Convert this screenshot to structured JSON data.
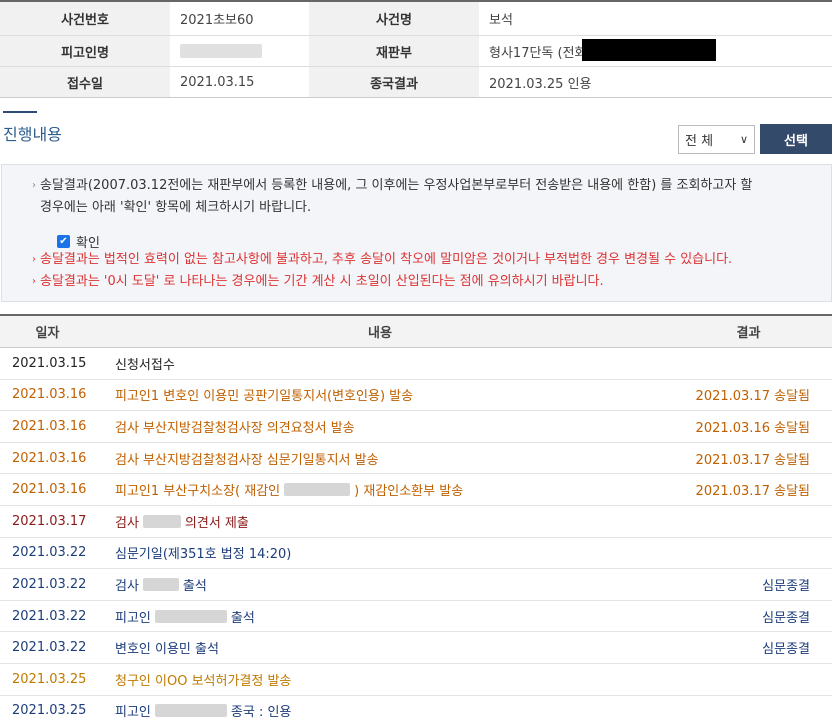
{
  "case_info": {
    "case_number_label": "사건번호",
    "case_number": "2021초보60",
    "case_name_label": "사건명",
    "case_name": "보석",
    "defendant_label": "피고인명",
    "court_label": "재판부",
    "court": "형사17단독 (전화",
    "filing_date_label": "접수일",
    "filing_date": "2021.03.15",
    "final_result_label": "종국결과",
    "final_result": "2021.03.25 인용"
  },
  "section_title": "진행내용",
  "filter": {
    "selected": "전 체",
    "button": "선택"
  },
  "notice": {
    "line1": "송달결과(2007.03.12전에는 재판부에서 등록한 내용에, 그 이후에는 우정사업본부로부터 전송받은 내용에 한함) 를 조회하고자 할",
    "line2": "경우에는 아래 '확인' 항목에 체크하시기 바랍니다.",
    "checkbox_label": "확인",
    "warn1": "송달결과는 법적인 효력이 없는 참고사항에 불과하고, 추후 송달이 착오에 말미암은 것이거나 부적법한 경우 변경될 수 있습니다.",
    "warn2": "송달결과는 '0시 도달' 로 나타나는 경우에는 기간 계산 시 초일이 산입된다는 점에 유의하시기 바랍니다."
  },
  "table": {
    "headers": {
      "date": "일자",
      "content": "내용",
      "result": "결과"
    },
    "rows": [
      {
        "date": "2021.03.15",
        "pre": "신청서접수",
        "post": "",
        "result": "",
        "color": "black"
      },
      {
        "date": "2021.03.16",
        "pre": "피고인1 변호인 이용민 공판기일통지서(변호인용) 발송",
        "post": "",
        "result": "2021.03.17 송달됨",
        "color": "orange"
      },
      {
        "date": "2021.03.16",
        "pre": "검사 부산지방검찰청검사장 의견요청서 발송",
        "post": "",
        "result": "2021.03.16 송달됨",
        "color": "orange"
      },
      {
        "date": "2021.03.16",
        "pre": "검사 부산지방검찰청검사장 심문기일통지서 발송",
        "post": "",
        "result": "2021.03.17 송달됨",
        "color": "orange"
      },
      {
        "date": "2021.03.16",
        "pre": "피고인1 부산구치소장( 재감인",
        "post": ") 재감인소환부 발송",
        "result": "2021.03.17 송달됨",
        "color": "orange"
      },
      {
        "date": "2021.03.17",
        "pre": "검사",
        "post": "의견서 제출",
        "result": "",
        "color": "maroon"
      },
      {
        "date": "2021.03.22",
        "pre": "심문기일(제351호 법정 14:20)",
        "post": "",
        "result": "",
        "color": "blue"
      },
      {
        "date": "2021.03.22",
        "pre": "검사",
        "post": "출석",
        "result": "심문종결",
        "color": "blue"
      },
      {
        "date": "2021.03.22",
        "pre": "피고인",
        "post": "출석",
        "result": "심문종결",
        "color": "blue"
      },
      {
        "date": "2021.03.22",
        "pre": "변호인 이용민 출석",
        "post": "",
        "result": "심문종결",
        "color": "blue"
      },
      {
        "date": "2021.03.25",
        "pre": "청구인 이OO 보석허가결정 발송",
        "post": "",
        "result": "",
        "color": "gold"
      },
      {
        "date": "2021.03.25",
        "pre": "피고인",
        "post": "종국 : 인용",
        "result": "",
        "color": "blue"
      }
    ]
  }
}
